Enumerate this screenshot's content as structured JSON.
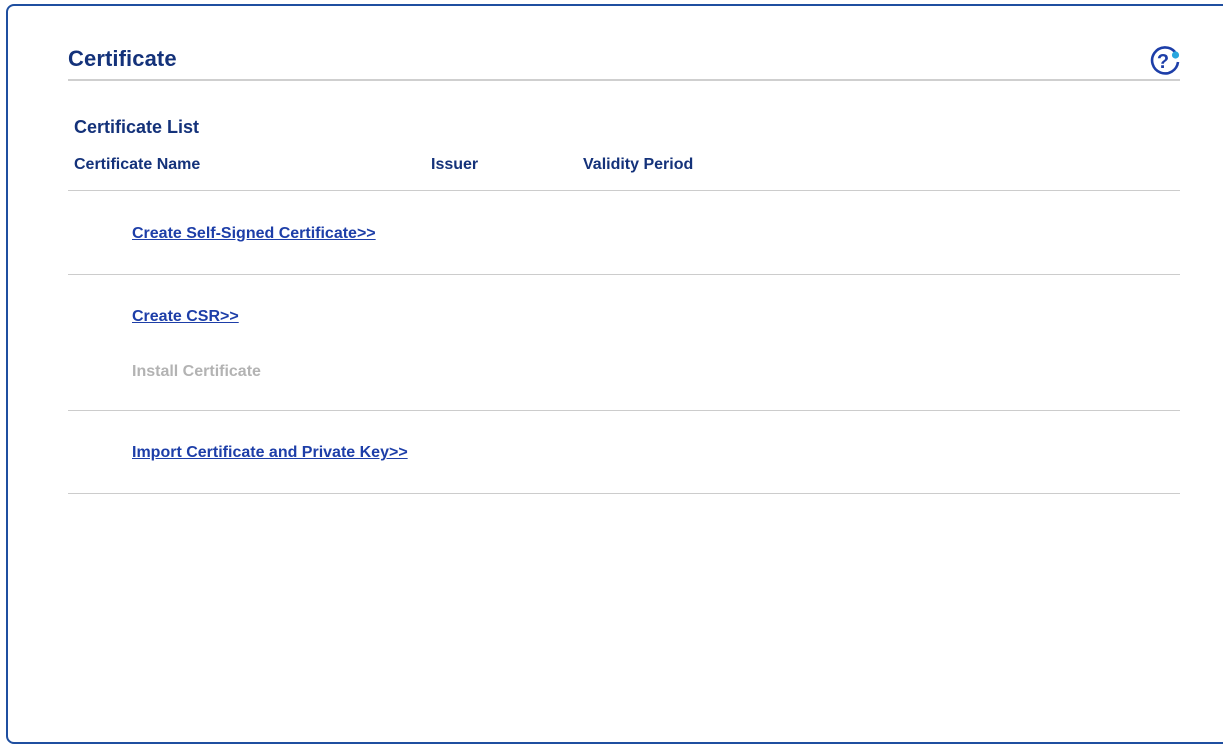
{
  "page": {
    "title": "Certificate"
  },
  "help": {
    "icon": "help-icon",
    "glyph": "?"
  },
  "certificate_list": {
    "title": "Certificate List",
    "columns": [
      "Certificate Name",
      "Issuer",
      "Validity Period"
    ],
    "rows": []
  },
  "actions": {
    "create_self_signed": "Create Self-Signed Certificate>>",
    "create_csr": "Create CSR>>",
    "install_certificate": "Install Certificate",
    "import_certificate": "Import Certificate and Private Key>>"
  },
  "colors": {
    "heading": "#14327a",
    "link": "#1d3ea8",
    "disabled": "#b3b3b3",
    "frame": "#1f4fa0"
  }
}
